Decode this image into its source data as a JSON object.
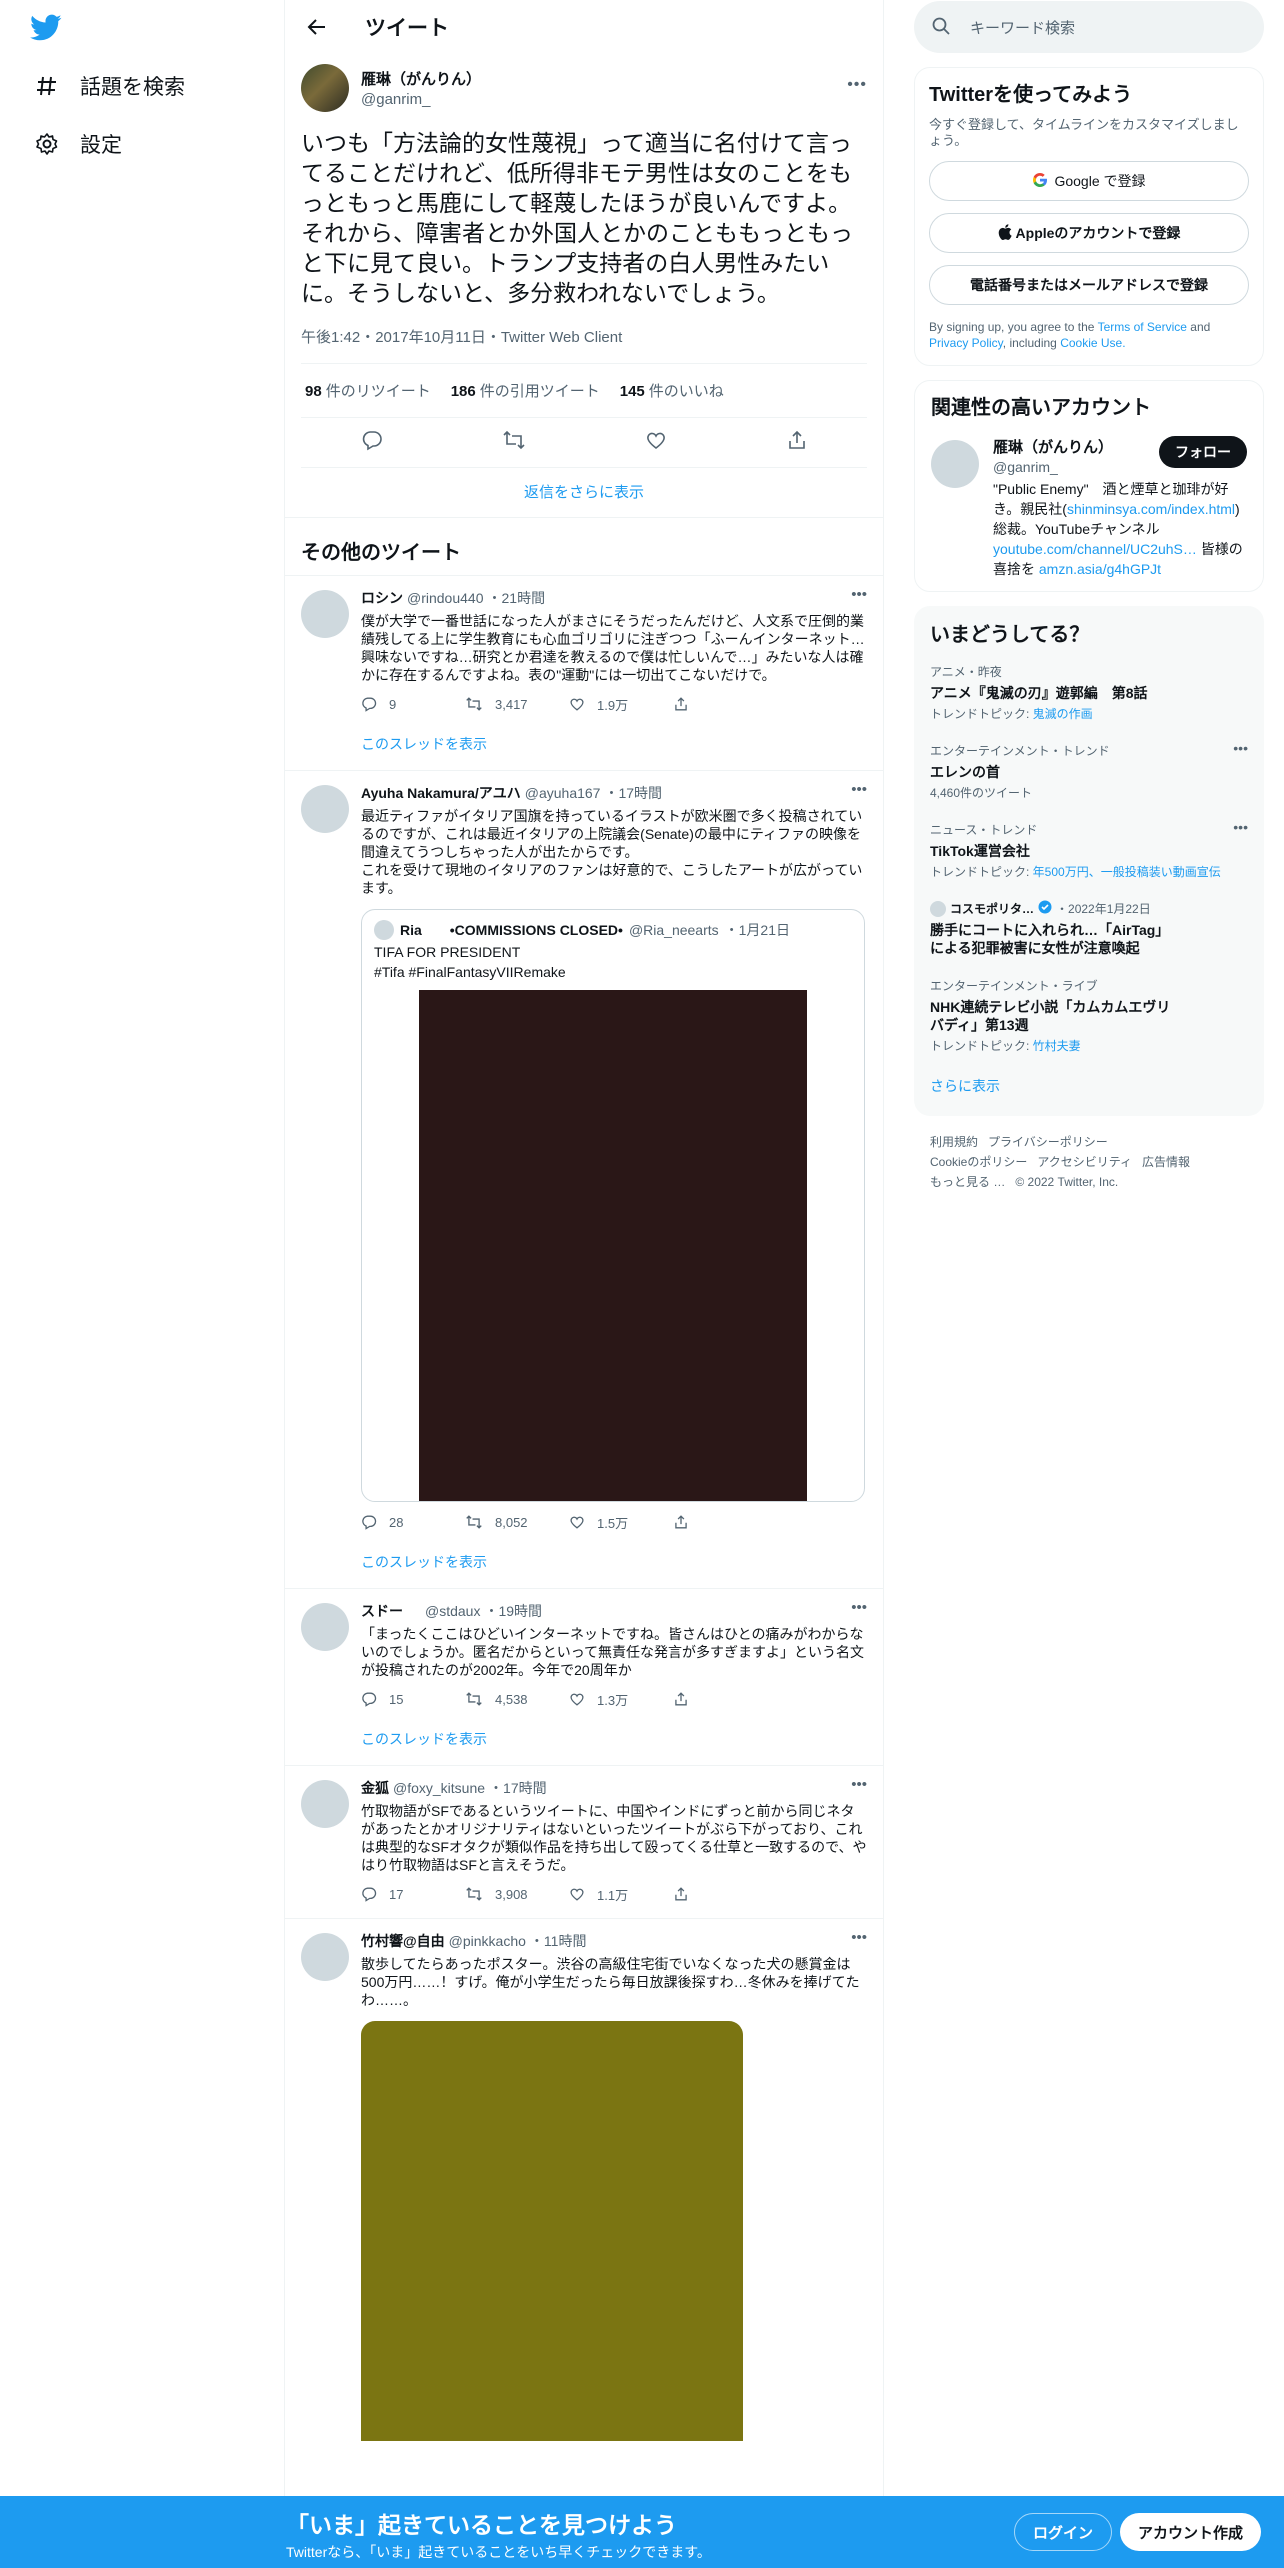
{
  "nav": {
    "logo": "twitter-bird",
    "items": [
      {
        "label": "話題を検索",
        "icon": "hashtag-icon"
      },
      {
        "label": "設定",
        "icon": "gear-icon"
      }
    ]
  },
  "header": {
    "title": "ツイート"
  },
  "main_tweet": {
    "name": "雁琳（がんりん）",
    "handle": "@ganrim_",
    "text": "いつも「方法論的女性蔑視」って適当に名付けて言ってることだけれど、低所得非モテ男性は女のことをもっともっと馬鹿にして軽蔑したほうが良いんですよ。それから、障害者とか外国人とかのことももっともっと下に見て良い。トランプ支持者の白人男性みたいに。そうしないと、多分救われないでしょう。",
    "meta": "午後1:42・2017年10月11日・Twitter Web Client",
    "stats": [
      {
        "num": "98",
        "label": "件のリツイート"
      },
      {
        "num": "186",
        "label": "件の引用ツイート"
      },
      {
        "num": "145",
        "label": "件のいいね"
      }
    ],
    "show_more_replies": "返信をさらに表示"
  },
  "other_tweets_title": "その他のツイート",
  "tweets": [
    {
      "name": "ロシン",
      "handle": "@rindou440",
      "time": "・21時間",
      "text": "僕が大学で一番世話になった人がまさにそうだったんだけど、人文系で圧倒的業績残してる上に学生教育にも心血ゴリゴリに注ぎつつ「ふーんインターネット…興味ないですね…研究とか君達を教えるので僕は忙しいんで…」みたいな人は確かに存在するんですよね。表の\"運動\"には一切出てこないだけで。",
      "replies": "9",
      "retweets": "3,417",
      "likes": "1.9万",
      "thread": "このスレッドを表示"
    },
    {
      "name": "Ayuha Nakamura/アユハ",
      "handle": "@ayuha167",
      "time": "・17時間",
      "text": "最近ティファがイタリア国旗を持っているイラストが欧米圏で多く投稿されているのですが、これは最近イタリアの上院議会(Senate)の最中にティファの映像を間違えてうつしちゃった人が出たからです。\nこれを受けて現地のイタリアのファンは好意的で、こうしたアートが広がっています。",
      "quote": {
        "name": "Ria　　•COMMISSIONS CLOSED•",
        "handle": "@Ria_neearts",
        "time": "・1月21日",
        "text": "TIFA FOR PRESIDENT\n#Tifa #FinalFantasyVIIRemake"
      },
      "replies": "28",
      "retweets": "8,052",
      "likes": "1.5万",
      "thread": "このスレッドを表示"
    },
    {
      "name": "スドー",
      "handle": "@stdaux",
      "time": "・19時間",
      "text": "「まったくここはひどいインターネットですね。皆さんはひとの痛みがわからないのでしょうか。匿名だからといって無責任な発言が多すぎますよ」という名文が投稿されたのが2002年。今年で20周年か",
      "replies": "15",
      "retweets": "4,538",
      "likes": "1.3万",
      "thread": "このスレッドを表示"
    },
    {
      "name": "金狐",
      "handle": "@foxy_kitsune",
      "time": "・17時間",
      "text": "竹取物語がSFであるというツイートに、中国やインドにずっと前から同じネタがあったとかオリジナリティはないといったツイートがぶら下がっており、これは典型的なSFオタクが類似作品を持ち出して殴ってくる仕草と一致するので、やはり竹取物語はSFと言えそうだ。",
      "replies": "17",
      "retweets": "3,908",
      "likes": "1.1万"
    },
    {
      "name": "竹村響@自由",
      "handle": "@pinkkacho",
      "time": "・11時間",
      "text": "散歩してたらあったポスター。渋谷の高級住宅街でいなくなった犬の懸賞金は500万円……！すげ。俺が小学生だったら毎日放課後探すわ…冬休みを捧げてたわ……。"
    }
  ],
  "search": {
    "placeholder": "キーワード検索"
  },
  "signup": {
    "title": "Twitterを使ってみよう",
    "sub": "今すぐ登録して、タイムラインをカスタマイズしましょう。",
    "google": "Google で登録",
    "apple": "Appleのアカウントで登録",
    "phone": "電話番号またはメールアドレスで登録",
    "terms_prefix": "By signing up, you agree to the",
    "terms_link": "Terms of Service",
    "and": "and",
    "privacy_link": "Privacy Policy",
    "including": ", including",
    "cookie_link": "Cookie Use."
  },
  "related": {
    "title": "関連性の高いアカウント",
    "name": "雁琳（がんりん）",
    "handle": "@ganrim_",
    "follow": "フォロー",
    "bio1": "\"Public Enemy\"　酒と煙草と珈琲が好き。親民社(",
    "link1": "shinminsya.com/index.html",
    "bio2": ")総裁。YouTubeチャンネル",
    "link2": "youtube.com/channel/UC2uhS…",
    "bio3": " 皆様の喜捨を ",
    "link3": "amzn.asia/g4hGPJt"
  },
  "trends": {
    "title": "いまどうしてる？",
    "items": [
      {
        "meta": "アニメ・昨夜",
        "name": "アニメ『鬼滅の刃』遊郭編　第8話",
        "sub_prefix": "トレンドトピック: ",
        "sub_link": "鬼滅の作画"
      },
      {
        "meta": "エンターテインメント・トレンド",
        "name": "エレンの首",
        "sub": "4,460件のツイート"
      },
      {
        "meta": "ニュース・トレンド",
        "name": "TikTok運営会社",
        "sub_prefix": "トレンドトピック: ",
        "sub_link": "年500万円、一般投稿装い動画宣伝"
      },
      {
        "meta_name": "コスモポリタ…",
        "meta_date": "・2022年1月22日",
        "name": "勝手にコートに入れられ…「AirTag」による犯罪被害に女性が注意喚起"
      },
      {
        "meta": "エンターテインメント・ライブ",
        "name": "NHK連続テレビ小説「カムカムエヴリバディ」第13週",
        "sub_prefix": "トレンドトピック: ",
        "sub_link": "竹村夫妻"
      }
    ],
    "more": "さらに表示"
  },
  "footer": {
    "links1": [
      "利用規約",
      "プライバシーポリシー"
    ],
    "links2": [
      "Cookieのポリシー",
      "アクセシビリティ",
      "広告情報"
    ],
    "more": "もっと見る …",
    "copyright": "© 2022 Twitter, Inc."
  },
  "bottombar": {
    "title": "「いま」起きていることを見つけよう",
    "sub": "Twitterなら、「いま」起きていることをいち早くチェックできます。",
    "login": "ログイン",
    "signup": "アカウント作成"
  },
  "colors": {
    "accent": "#1d9bf0",
    "text": "#0f1419",
    "muted": "#536471",
    "bottombar": "#1d9bf0"
  }
}
